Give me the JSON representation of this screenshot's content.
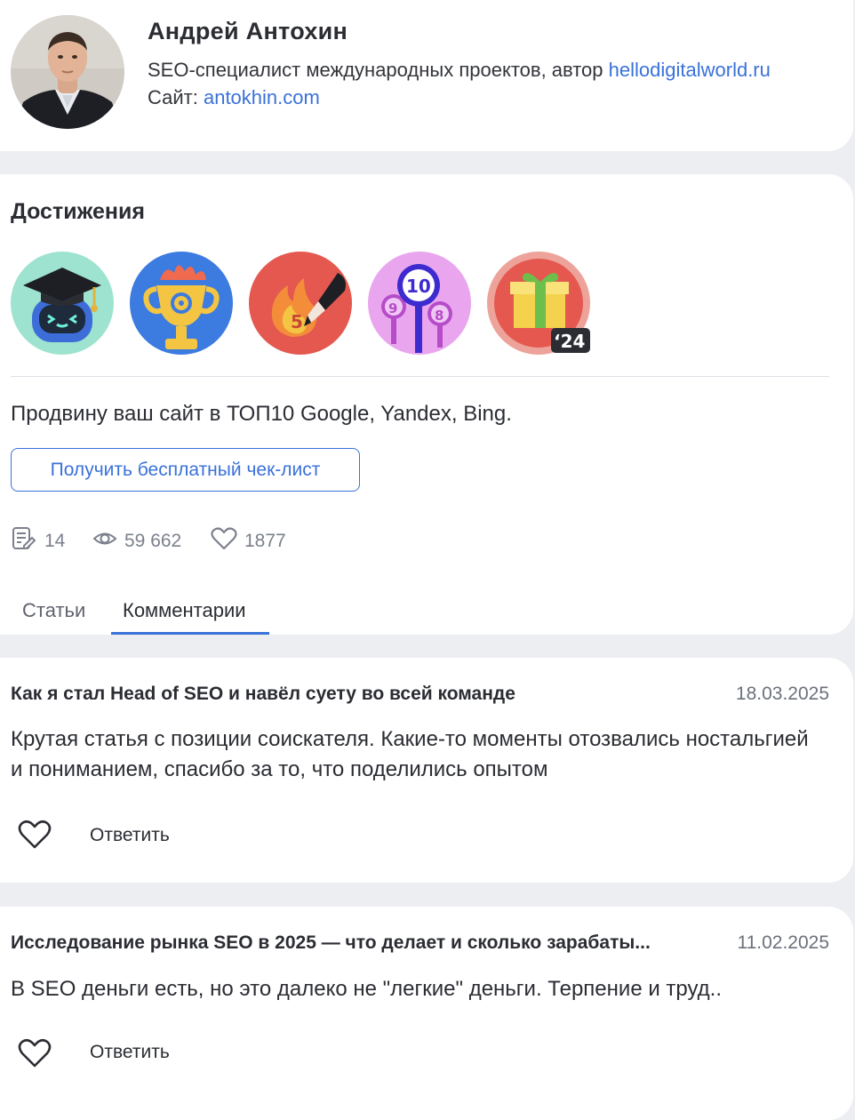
{
  "profile": {
    "name": "Андрей Антохин",
    "description_prefix": "SEO-специалист международных проектов, автор ",
    "description_link": "hellodigitalworld.ru",
    "site_label": "Сайт: ",
    "site_link": "antokhin.com"
  },
  "achievements": {
    "title": "Достижения",
    "badges": [
      {
        "icon": "graduation-robot-icon",
        "color": "#9ee3cf"
      },
      {
        "icon": "trophy-icon",
        "color": "#3c7be0"
      },
      {
        "icon": "flame-pen-icon",
        "color": "#e4584f",
        "number": "5"
      },
      {
        "icon": "ranking-pins-icon",
        "color": "#e9a6ee",
        "numbers": [
          "9",
          "10",
          "8"
        ]
      },
      {
        "icon": "gift-icon",
        "color": "#e4584f",
        "tag": "‘24"
      }
    ]
  },
  "promo": {
    "text": "Продвину ваш сайт в ТОП10 Google, Yandex, Bing.",
    "button_label": "Получить бесплатный чек-лист"
  },
  "stats": {
    "articles": "14",
    "views": "59 662",
    "likes": "1877"
  },
  "tabs": {
    "articles": "Статьи",
    "comments": "Комментарии",
    "active": "comments"
  },
  "comments": [
    {
      "title": "Как я стал Head of SEO и навёл суету во всей команде",
      "date": "18.03.2025",
      "text": "Крутая статья с позиции соискателя. Какие-то моменты отозвались ностальгией и пониманием, спасибо за то, что поделились опытом",
      "reply_label": "Ответить"
    },
    {
      "title": "Исследование рынка SEO в 2025 — что делает и сколько зарабаты...",
      "date": "11.02.2025",
      "text": "В SEO деньги есть, но это далеко не \"легкие\" деньги. Терпение и труд..",
      "reply_label": "Ответить"
    }
  ],
  "colors": {
    "accent": "#3a72d8",
    "background": "#eceef2",
    "card": "#ffffff"
  }
}
